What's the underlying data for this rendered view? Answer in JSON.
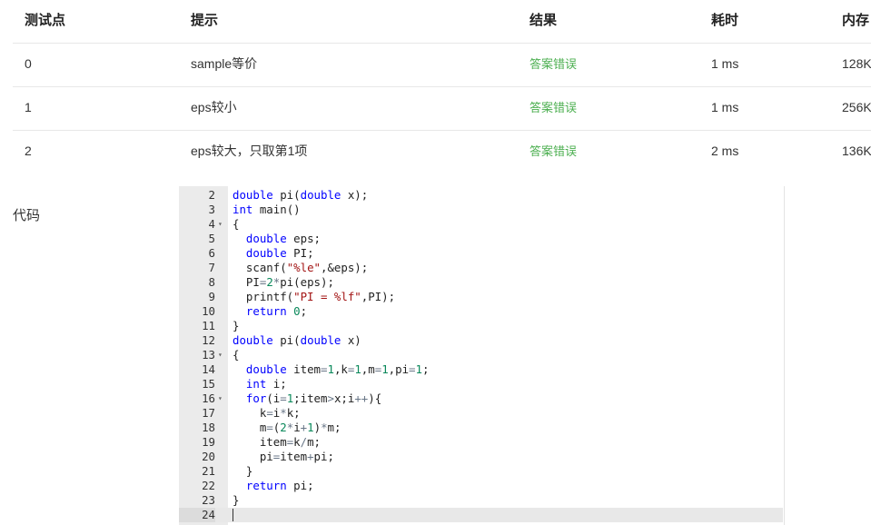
{
  "table": {
    "headers": [
      "测试点",
      "提示",
      "结果",
      "耗时",
      "内存"
    ],
    "rows": [
      {
        "id": "0",
        "hint": "sample等价",
        "result": "答案错误",
        "time": "1 ms",
        "memory": "128K"
      },
      {
        "id": "1",
        "hint": "eps较小",
        "result": "答案错误",
        "time": "1 ms",
        "memory": "256K"
      },
      {
        "id": "2",
        "hint": "eps较大，只取第1项",
        "result": "答案错误",
        "time": "2 ms",
        "memory": "136K"
      }
    ]
  },
  "code_label": "代码",
  "colors": {
    "status_error_text": "#4caf50",
    "keyword": "#0000ff",
    "string": "#a31515",
    "number": "#09885a"
  },
  "code_lines": [
    {
      "n": "2",
      "fold": false,
      "tokens": [
        [
          "kw",
          "double"
        ],
        [
          "",
          " pi("
        ],
        [
          "kw",
          "double"
        ],
        [
          "",
          " x);"
        ]
      ]
    },
    {
      "n": "3",
      "fold": false,
      "tokens": [
        [
          "kw",
          "int"
        ],
        [
          "",
          " main()"
        ]
      ]
    },
    {
      "n": "4",
      "fold": true,
      "tokens": [
        [
          "",
          "{"
        ]
      ]
    },
    {
      "n": "5",
      "fold": false,
      "tokens": [
        [
          "",
          "  "
        ],
        [
          "kw",
          "double"
        ],
        [
          "",
          " eps;"
        ]
      ]
    },
    {
      "n": "6",
      "fold": false,
      "tokens": [
        [
          "",
          "  "
        ],
        [
          "kw",
          "double"
        ],
        [
          "",
          " PI;"
        ]
      ]
    },
    {
      "n": "7",
      "fold": false,
      "tokens": [
        [
          "",
          "  scanf("
        ],
        [
          "str",
          "\"%le\""
        ],
        [
          "",
          ",&eps);"
        ]
      ]
    },
    {
      "n": "8",
      "fold": false,
      "tokens": [
        [
          "",
          "  PI"
        ],
        [
          "op",
          "="
        ],
        [
          "num",
          "2"
        ],
        [
          "op",
          "*"
        ],
        [
          "",
          "pi(eps);"
        ]
      ]
    },
    {
      "n": "9",
      "fold": false,
      "tokens": [
        [
          "",
          "  printf("
        ],
        [
          "str",
          "\"PI = %lf\""
        ],
        [
          "",
          ",PI);"
        ]
      ]
    },
    {
      "n": "10",
      "fold": false,
      "tokens": [
        [
          "",
          "  "
        ],
        [
          "kw",
          "return"
        ],
        [
          "",
          " "
        ],
        [
          "num",
          "0"
        ],
        [
          "",
          ";"
        ]
      ]
    },
    {
      "n": "11",
      "fold": false,
      "tokens": [
        [
          "",
          "}"
        ]
      ]
    },
    {
      "n": "12",
      "fold": false,
      "tokens": [
        [
          "kw",
          "double"
        ],
        [
          "",
          " pi("
        ],
        [
          "kw",
          "double"
        ],
        [
          "",
          " x)"
        ]
      ]
    },
    {
      "n": "13",
      "fold": true,
      "tokens": [
        [
          "",
          "{"
        ]
      ]
    },
    {
      "n": "14",
      "fold": false,
      "tokens": [
        [
          "",
          "  "
        ],
        [
          "kw",
          "double"
        ],
        [
          "",
          " item"
        ],
        [
          "op",
          "="
        ],
        [
          "num",
          "1"
        ],
        [
          "",
          ",k"
        ],
        [
          "op",
          "="
        ],
        [
          "num",
          "1"
        ],
        [
          "",
          ",m"
        ],
        [
          "op",
          "="
        ],
        [
          "num",
          "1"
        ],
        [
          "",
          ",pi"
        ],
        [
          "op",
          "="
        ],
        [
          "num",
          "1"
        ],
        [
          "",
          ";"
        ]
      ]
    },
    {
      "n": "15",
      "fold": false,
      "tokens": [
        [
          "",
          "  "
        ],
        [
          "kw",
          "int"
        ],
        [
          "",
          " i;"
        ]
      ]
    },
    {
      "n": "16",
      "fold": true,
      "tokens": [
        [
          "",
          "  "
        ],
        [
          "kw",
          "for"
        ],
        [
          "",
          "(i"
        ],
        [
          "op",
          "="
        ],
        [
          "num",
          "1"
        ],
        [
          "",
          ";item"
        ],
        [
          "op",
          ">"
        ],
        [
          "",
          "x;i"
        ],
        [
          "op",
          "++"
        ],
        [
          "",
          "){"
        ]
      ]
    },
    {
      "n": "17",
      "fold": false,
      "tokens": [
        [
          "",
          "    k"
        ],
        [
          "op",
          "="
        ],
        [
          "",
          "i"
        ],
        [
          "op",
          "*"
        ],
        [
          "",
          "k;"
        ]
      ]
    },
    {
      "n": "18",
      "fold": false,
      "tokens": [
        [
          "",
          "    m"
        ],
        [
          "op",
          "="
        ],
        [
          "",
          "("
        ],
        [
          "num",
          "2"
        ],
        [
          "op",
          "*"
        ],
        [
          "",
          "i"
        ],
        [
          "op",
          "+"
        ],
        [
          "num",
          "1"
        ],
        [
          "",
          ")"
        ],
        [
          "op",
          "*"
        ],
        [
          "",
          "m;"
        ]
      ]
    },
    {
      "n": "19",
      "fold": false,
      "tokens": [
        [
          "",
          "    item"
        ],
        [
          "op",
          "="
        ],
        [
          "",
          "k"
        ],
        [
          "op",
          "/"
        ],
        [
          "",
          "m;"
        ]
      ]
    },
    {
      "n": "20",
      "fold": false,
      "tokens": [
        [
          "",
          "    pi"
        ],
        [
          "op",
          "="
        ],
        [
          "",
          "item"
        ],
        [
          "op",
          "+"
        ],
        [
          "",
          "pi;"
        ]
      ]
    },
    {
      "n": "21",
      "fold": false,
      "tokens": [
        [
          "",
          "  }"
        ]
      ]
    },
    {
      "n": "22",
      "fold": false,
      "tokens": [
        [
          "",
          "  "
        ],
        [
          "kw",
          "return"
        ],
        [
          "",
          " pi;"
        ]
      ]
    },
    {
      "n": "23",
      "fold": false,
      "tokens": [
        [
          "",
          "}"
        ]
      ]
    },
    {
      "n": "24",
      "fold": false,
      "active": true,
      "tokens": []
    }
  ]
}
